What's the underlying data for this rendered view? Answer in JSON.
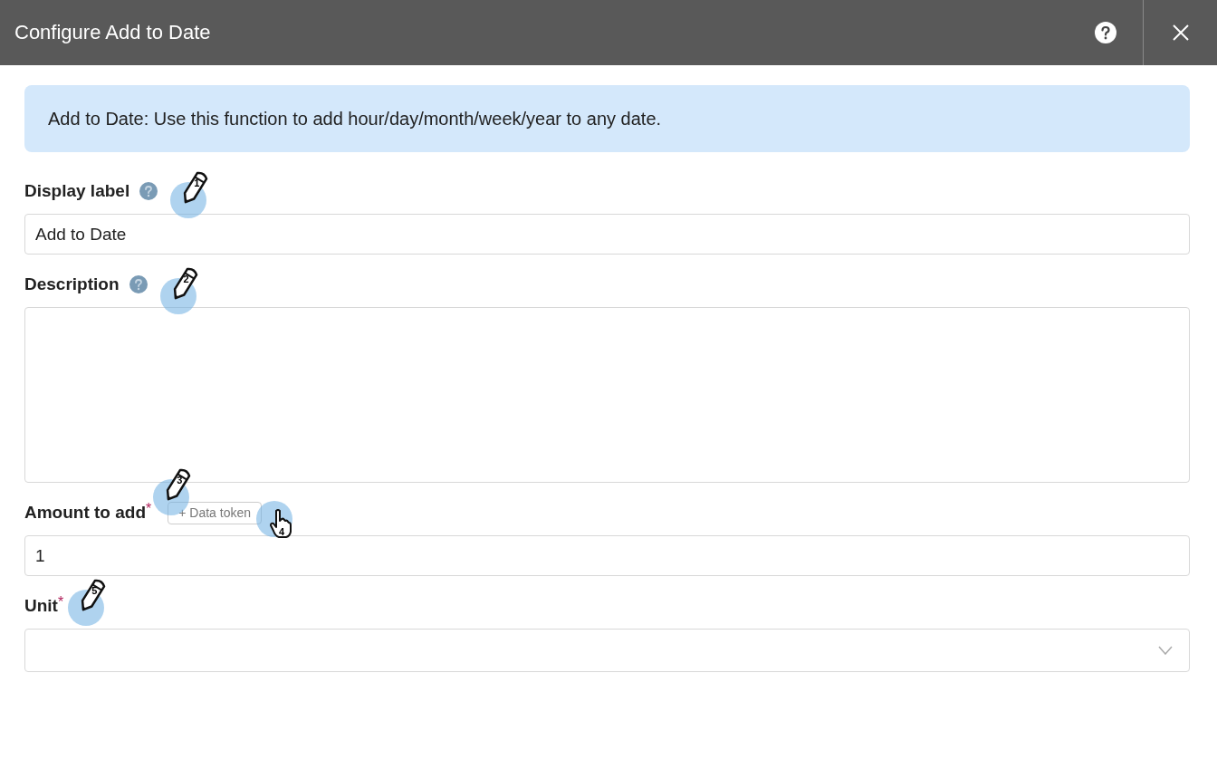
{
  "window": {
    "title": "Configure Add to Date"
  },
  "info": "Add to Date: Use this function to add hour/day/month/week/year to any date.",
  "fields": [
    {
      "kind": "text",
      "label": "Display label",
      "help": true,
      "value": "Add to Date",
      "marker": {
        "number": "1",
        "kind": "pencil"
      }
    },
    {
      "kind": "textarea",
      "label": "Description",
      "help": true,
      "marker": {
        "number": "2",
        "kind": "pencil"
      }
    },
    {
      "kind": "text",
      "label": "Amount to add",
      "required_mark": "*",
      "token_button": "+ Data token",
      "value": "1",
      "marker": {
        "number": "3",
        "kind": "pencil"
      },
      "token_marker": {
        "number": "4",
        "kind": "hand"
      }
    },
    {
      "kind": "select",
      "label": "Unit",
      "required_mark": "*",
      "marker": {
        "number": "5",
        "kind": "pencil"
      }
    }
  ]
}
